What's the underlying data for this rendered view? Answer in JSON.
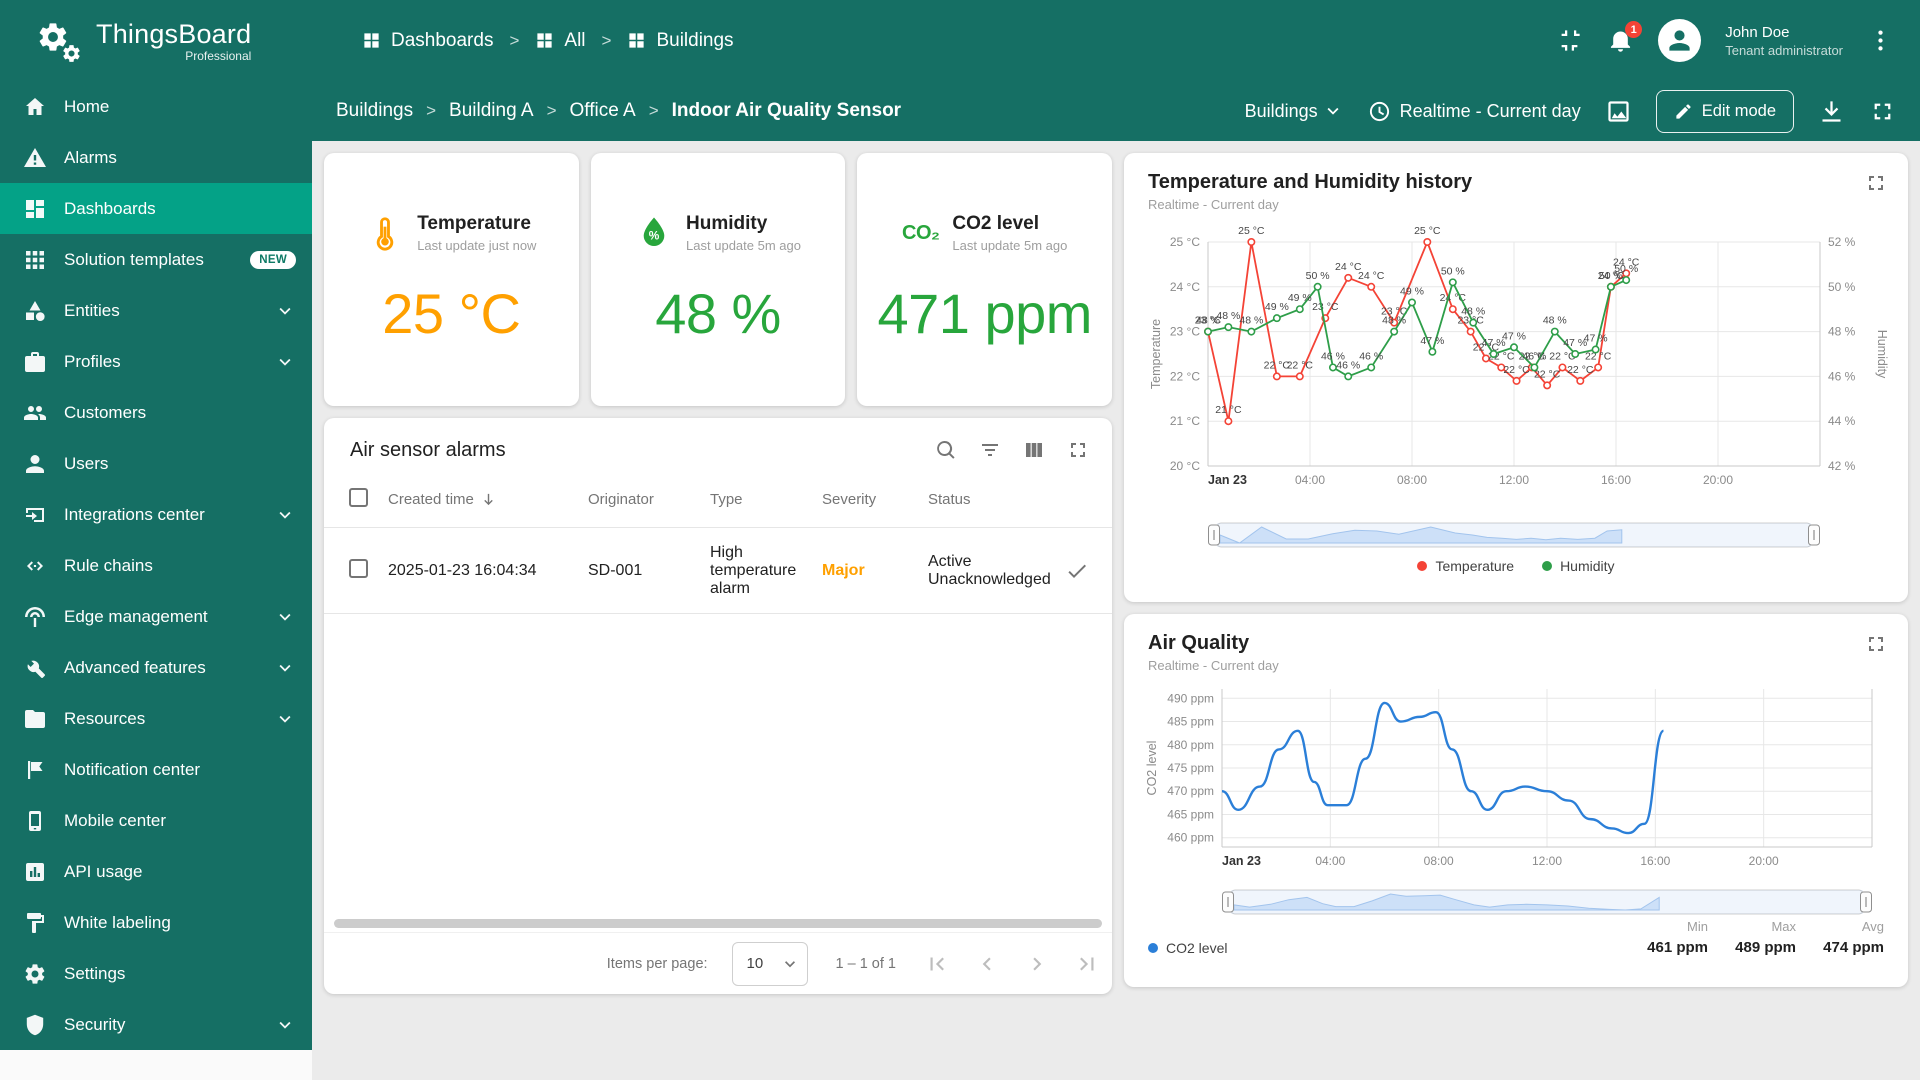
{
  "brand": {
    "name": "ThingsBoard",
    "edition": "Professional"
  },
  "header": {
    "nav": [
      {
        "label": "Dashboards",
        "icon": "grid"
      },
      {
        "label": "All",
        "icon": "grid"
      },
      {
        "label": "Buildings",
        "icon": "grid"
      }
    ],
    "notification_count": "1",
    "user": {
      "name": "John Doe",
      "role": "Tenant administrator"
    }
  },
  "toolbar": {
    "breadcrumb": [
      "Buildings",
      "Building A",
      "Office A"
    ],
    "current": "Indoor Air Quality Sensor",
    "entity_label": "Buildings",
    "timewindow": "Realtime - Current day",
    "edit_button": "Edit mode"
  },
  "sidebar": [
    {
      "label": "Home",
      "icon": "home"
    },
    {
      "label": "Alarms",
      "icon": "alarms"
    },
    {
      "label": "Dashboards",
      "icon": "dashboards",
      "active": true
    },
    {
      "label": "Solution templates",
      "icon": "apps",
      "badge": "NEW"
    },
    {
      "label": "Entities",
      "icon": "entities",
      "expandable": true
    },
    {
      "label": "Profiles",
      "icon": "profiles",
      "expandable": true
    },
    {
      "label": "Customers",
      "icon": "customers"
    },
    {
      "label": "Users",
      "icon": "users"
    },
    {
      "label": "Integrations center",
      "icon": "integrations",
      "expandable": true
    },
    {
      "label": "Rule chains",
      "icon": "rulechains"
    },
    {
      "label": "Edge management",
      "icon": "edge",
      "expandable": true
    },
    {
      "label": "Advanced features",
      "icon": "advanced",
      "expandable": true
    },
    {
      "label": "Resources",
      "icon": "resources",
      "expandable": true
    },
    {
      "label": "Notification center",
      "icon": "notification"
    },
    {
      "label": "Mobile center",
      "icon": "mobile"
    },
    {
      "label": "API usage",
      "icon": "api"
    },
    {
      "label": "White labeling",
      "icon": "whitelabel"
    },
    {
      "label": "Settings",
      "icon": "settings"
    },
    {
      "label": "Security",
      "icon": "security",
      "expandable": true
    }
  ],
  "kpis": [
    {
      "title": "Temperature",
      "subtitle": "Last update just now",
      "value": "25 °C",
      "color": "#FFA000",
      "icon": "thermometer"
    },
    {
      "title": "Humidity",
      "subtitle": "Last update 5m ago",
      "value": "48 %",
      "color": "#28A63C",
      "icon": "humidity"
    },
    {
      "title": "CO2 level",
      "subtitle": "Last update 5m ago",
      "value": "471 ppm",
      "color": "#28A63C",
      "icon": "co2",
      "icon_text": "CO₂"
    }
  ],
  "alarms": {
    "title": "Air sensor alarms",
    "columns": [
      "Created time",
      "Originator",
      "Type",
      "Severity",
      "Status"
    ],
    "rows": [
      {
        "created": "2025-01-23 16:04:34",
        "originator": "SD-001",
        "type": "High temperature alarm",
        "severity": "Major",
        "severity_color": "#FFA000",
        "status": [
          "Active",
          "Unacknowledged"
        ]
      }
    ],
    "pagination": {
      "label": "Items per page:",
      "page_size": "10",
      "range": "1 – 1 of 1"
    }
  },
  "chart_data": [
    {
      "type": "line",
      "title": "Temperature and Humidity history",
      "subtitle": "Realtime - Current day",
      "x_axis": {
        "range": [
          0,
          24
        ],
        "ticks": [
          {
            "pos": 0,
            "label": "Jan 23",
            "bold": true
          },
          {
            "pos": 4,
            "label": "04:00"
          },
          {
            "pos": 8,
            "label": "08:00"
          },
          {
            "pos": 12,
            "label": "12:00"
          },
          {
            "pos": 16,
            "label": "16:00"
          },
          {
            "pos": 20,
            "label": "20:00"
          }
        ]
      },
      "left_axis": {
        "label": "Temperature",
        "unit": "°C",
        "ticks": [
          25,
          24,
          23,
          22,
          21,
          20
        ],
        "range": [
          20,
          25
        ]
      },
      "right_axis": {
        "label": "Humidity",
        "unit": "%",
        "ticks": [
          52,
          50,
          48,
          46,
          44,
          42
        ],
        "range": [
          42,
          52
        ]
      },
      "legend_position": "bottom",
      "grid": true,
      "series": [
        {
          "name": "Temperature",
          "color": "#F44336",
          "axis": "left",
          "unit": "°C",
          "points": [
            [
              0,
              23
            ],
            [
              0.8,
              21
            ],
            [
              1.7,
              25
            ],
            [
              2.7,
              22
            ],
            [
              3.6,
              22
            ],
            [
              4.6,
              23.3
            ],
            [
              5.5,
              24.2
            ],
            [
              6.4,
              24
            ],
            [
              7.3,
              23.2
            ],
            [
              8.6,
              25
            ],
            [
              9.6,
              23.5
            ],
            [
              10.3,
              23
            ],
            [
              10.9,
              22.4
            ],
            [
              11.5,
              22.2
            ],
            [
              12.1,
              21.9
            ],
            [
              12.7,
              22.2
            ],
            [
              13.3,
              21.8
            ],
            [
              13.9,
              22.2
            ],
            [
              14.6,
              21.9
            ],
            [
              15.3,
              22.2
            ],
            [
              15.8,
              24
            ],
            [
              16.4,
              24.3
            ]
          ]
        },
        {
          "name": "Humidity",
          "color": "#2E9E49",
          "axis": "right",
          "unit": "%",
          "points": [
            [
              0,
              48
            ],
            [
              0.8,
              48.2
            ],
            [
              1.7,
              48
            ],
            [
              2.7,
              48.6
            ],
            [
              3.6,
              49
            ],
            [
              4.3,
              50
            ],
            [
              4.9,
              46.4
            ],
            [
              5.5,
              46
            ],
            [
              6.4,
              46.4
            ],
            [
              7.3,
              48
            ],
            [
              8,
              49.3
            ],
            [
              8.8,
              47.1
            ],
            [
              9.6,
              50.2
            ],
            [
              10.4,
              48.4
            ],
            [
              11.2,
              47
            ],
            [
              12,
              47.3
            ],
            [
              12.8,
              46.4
            ],
            [
              13.6,
              48
            ],
            [
              14.4,
              47
            ],
            [
              15.2,
              47.2
            ],
            [
              15.8,
              50
            ],
            [
              16.4,
              50.3
            ]
          ]
        }
      ]
    },
    {
      "type": "line",
      "title": "Air Quality",
      "subtitle": "Realtime - Current day",
      "x_axis": {
        "range": [
          0,
          24
        ],
        "ticks": [
          {
            "pos": 0,
            "label": "Jan 23",
            "bold": true
          },
          {
            "pos": 4,
            "label": "04:00"
          },
          {
            "pos": 8,
            "label": "08:00"
          },
          {
            "pos": 12,
            "label": "12:00"
          },
          {
            "pos": 16,
            "label": "16:00"
          },
          {
            "pos": 20,
            "label": "20:00"
          }
        ]
      },
      "left_axis": {
        "label": "CO2 level",
        "unit": "ppm",
        "ticks": [
          490,
          485,
          480,
          475,
          470,
          465,
          460
        ],
        "range": [
          458,
          492
        ]
      },
      "legend_position": "bottom-left",
      "grid": true,
      "series": [
        {
          "name": "CO2 level",
          "color": "#2B7FD8",
          "axis": "left",
          "unit": "ppm",
          "points": [
            [
              0,
              470
            ],
            [
              0.6,
              466
            ],
            [
              1.4,
              471
            ],
            [
              2.1,
              479
            ],
            [
              2.8,
              483
            ],
            [
              3.4,
              472
            ],
            [
              3.9,
              467
            ],
            [
              4.6,
              467
            ],
            [
              5.3,
              477
            ],
            [
              6,
              489
            ],
            [
              6.6,
              485
            ],
            [
              7.3,
              486
            ],
            [
              7.9,
              487
            ],
            [
              8.5,
              479
            ],
            [
              9.2,
              470
            ],
            [
              9.8,
              466
            ],
            [
              10.5,
              470
            ],
            [
              11.2,
              471
            ],
            [
              12,
              470
            ],
            [
              12.8,
              468
            ],
            [
              13.6,
              464
            ],
            [
              14.4,
              462
            ],
            [
              15,
              461
            ],
            [
              15.6,
              463
            ],
            [
              16.3,
              483
            ]
          ]
        }
      ],
      "stats": {
        "min_label": "Min",
        "max_label": "Max",
        "avg_label": "Avg",
        "min": "461 ppm",
        "max": "489 ppm",
        "avg": "474 ppm"
      }
    }
  ]
}
